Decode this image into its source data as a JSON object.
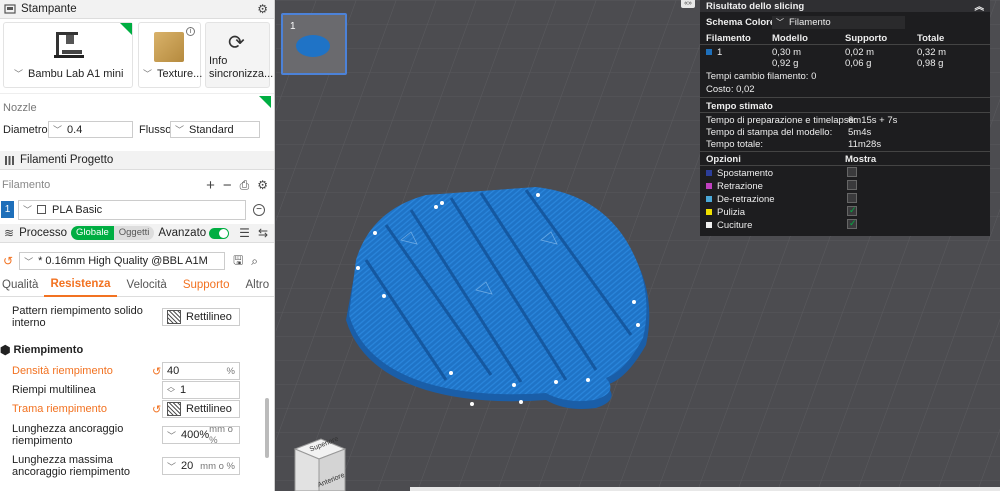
{
  "printer": {
    "title": "Stampante",
    "printer_name": "Bambu Lab A1 mini",
    "plate_name": "Texture...",
    "sync_label": "Info sincronizza...",
    "nozzle_label": "Nozzle",
    "diameter_label": "Diametro",
    "diameter_value": "0.4",
    "flow_label": "Flusso",
    "flow_value": "Standard"
  },
  "filaments": {
    "title": "Filamenti Progetto",
    "filament_label": "Filamento",
    "items": [
      {
        "index": "1",
        "name": "PLA Basic",
        "color": "#1e6fba"
      }
    ]
  },
  "process": {
    "title": "Processo",
    "global_label": "Globale",
    "objects_label": "Oggetti",
    "advanced_label": "Avanzato",
    "preset": "* 0.16mm High Quality @BBL A1M",
    "tabs": [
      "Qualità",
      "Resistenza",
      "Velocità",
      "Supporto",
      "Altro"
    ],
    "internal_pattern_label": "Pattern riempimento solido interno",
    "internal_pattern_value": "Rettilineo",
    "infill_section": "Riempimento",
    "density_label": "Densità riempimento",
    "density_value": "40",
    "density_unit": "%",
    "multiline_label": "Riempi multilinea",
    "multiline_value": "1",
    "pattern_label": "Trama riempimento",
    "pattern_value": "Rettilineo",
    "anchor_label": "Lunghezza ancoraggio riempimento",
    "anchor_value": "400%",
    "anchor_unit": "mm o %",
    "anchor_max_label": "Lunghezza massima ancoraggio riempimento",
    "anchor_max_value": "20",
    "anchor_max_unit": "mm o %"
  },
  "thumbnail": {
    "plate_number": "1"
  },
  "viewcube": {
    "top": "Superiore",
    "front": "Anteriore"
  },
  "slicing": {
    "title": "Risultato dello slicing",
    "scheme_label": "Schema Colore",
    "scheme_value": "Filamento",
    "headers": [
      "Filamento",
      "Modello",
      "Supporto",
      "Totale"
    ],
    "row": {
      "id": "1",
      "model_m": "0,30 m",
      "model_g": "0,92 g",
      "support_m": "0,02 m",
      "support_g": "0,06 g",
      "total_m": "0,32 m",
      "total_g": "0,98 g"
    },
    "change_time": "Tempi cambio filamento: 0",
    "cost": "Costo: 0,02",
    "time_title": "Tempo stimato",
    "prep_label": "Tempo di preparazione e timelapse:",
    "prep_value": "6m15s + 7s",
    "print_label": "Tempo di stampa del modello:",
    "print_value": "5m4s",
    "total_label": "Tempo totale:",
    "total_value": "11m28s",
    "options_label": "Opzioni",
    "show_label": "Mostra",
    "options": [
      {
        "label": "Spostamento",
        "color": "#2c3e9a",
        "checked": false
      },
      {
        "label": "Retrazione",
        "color": "#c040c0",
        "checked": false
      },
      {
        "label": "De-retrazione",
        "color": "#4aa8d8",
        "checked": false
      },
      {
        "label": "Pulizia",
        "color": "#f0e000",
        "checked": true
      },
      {
        "label": "Cuciture",
        "color": "#f0f0f0",
        "checked": true
      }
    ]
  }
}
